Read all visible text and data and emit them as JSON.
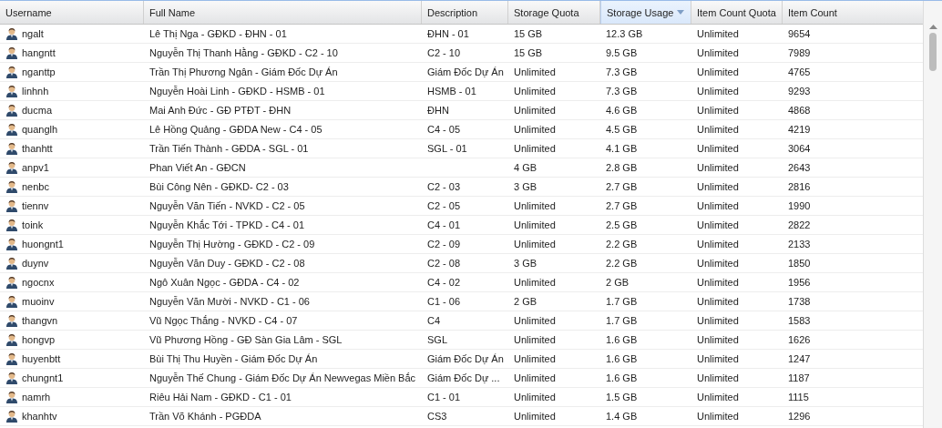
{
  "columns": [
    {
      "label": "Username",
      "sorted": false
    },
    {
      "label": "Full Name",
      "sorted": false
    },
    {
      "label": "Description",
      "sorted": false
    },
    {
      "label": "Storage Quota",
      "sorted": false
    },
    {
      "label": "Storage Usage",
      "sorted": true
    },
    {
      "label": "Item Count Quota",
      "sorted": false
    },
    {
      "label": "Item Count",
      "sorted": false
    }
  ],
  "rows": [
    [
      "ngalt",
      "Lê Thị Nga - GĐKD - ĐHN - 01",
      "ĐHN - 01",
      "15 GB",
      "12.3 GB",
      "Unlimited",
      "9654"
    ],
    [
      "hangntt",
      "Nguyễn Thị Thanh Hằng - GĐKD - C2 - 10",
      "C2 - 10",
      "15 GB",
      "9.5 GB",
      "Unlimited",
      "7989"
    ],
    [
      "nganttp",
      "Trần Thị Phương Ngân - Giám Đốc Dự Án",
      "Giám Đốc Dự Án",
      "Unlimited",
      "7.3 GB",
      "Unlimited",
      "4765"
    ],
    [
      "linhnh",
      "Nguyễn Hoài Linh - GĐKD - HSMB - 01",
      "HSMB - 01",
      "Unlimited",
      "7.3 GB",
      "Unlimited",
      "9293"
    ],
    [
      "ducma",
      "Mai Anh Đức - GĐ PTĐT - ĐHN",
      "ĐHN",
      "Unlimited",
      "4.6 GB",
      "Unlimited",
      "4868"
    ],
    [
      "quanglh",
      "Lê Hồng Quảng - GĐDA New - C4 - 05",
      "C4 - 05",
      "Unlimited",
      "4.5 GB",
      "Unlimited",
      "4219"
    ],
    [
      "thanhtt",
      "Trần Tiến Thành - GĐDA - SGL - 01",
      "SGL - 01",
      "Unlimited",
      "4.1 GB",
      "Unlimited",
      "3064"
    ],
    [
      "anpv1",
      "Phan Viết An - GĐCN",
      "",
      "4 GB",
      "2.8 GB",
      "Unlimited",
      "2643"
    ],
    [
      "nenbc",
      "Bùi Công Nên - GĐKD- C2 - 03",
      "C2 - 03",
      "3 GB",
      "2.7 GB",
      "Unlimited",
      "2816"
    ],
    [
      "tiennv",
      "Nguyễn Văn Tiến - NVKD - C2 - 05",
      "C2 - 05",
      "Unlimited",
      "2.7 GB",
      "Unlimited",
      "1990"
    ],
    [
      "toink",
      "Nguyễn Khắc Tới - TPKD - C4 - 01",
      "C4 - 01",
      "Unlimited",
      "2.5 GB",
      "Unlimited",
      "2822"
    ],
    [
      "huongnt1",
      "Nguyễn Thị Hường - GĐKD - C2 - 09",
      "C2 - 09",
      "Unlimited",
      "2.2 GB",
      "Unlimited",
      "2133"
    ],
    [
      "duynv",
      "Nguyễn Văn Duy - GĐKD - C2 - 08",
      "C2 - 08",
      "3 GB",
      "2.2 GB",
      "Unlimited",
      "1850"
    ],
    [
      "ngocnx",
      "Ngô Xuân Ngọc - GĐDA - C4 - 02",
      "C4 - 02",
      "Unlimited",
      "2 GB",
      "Unlimited",
      "1956"
    ],
    [
      "muoinv",
      "Nguyễn Văn Mười - NVKD - C1 - 06",
      "C1 - 06",
      "2 GB",
      "1.7 GB",
      "Unlimited",
      "1738"
    ],
    [
      "thangvn",
      "Vũ Ngọc Thắng - NVKD - C4 - 07",
      "C4",
      "Unlimited",
      "1.7 GB",
      "Unlimited",
      "1583"
    ],
    [
      "hongvp",
      "Vũ Phương Hồng - GĐ Sàn Gia Lâm - SGL",
      "SGL",
      "Unlimited",
      "1.6 GB",
      "Unlimited",
      "1626"
    ],
    [
      "huyenbtt",
      "Bùi Thị Thu Huyền - Giám Đốc Dự Án",
      "Giám Đốc Dự Án",
      "Unlimited",
      "1.6 GB",
      "Unlimited",
      "1247"
    ],
    [
      "chungnt1",
      "Nguyễn Thế Chung - Giám Đốc Dự Án Newvegas Miền Bắc",
      "Giám Đốc Dự ...",
      "Unlimited",
      "1.6 GB",
      "Unlimited",
      "1187"
    ],
    [
      "namrh",
      "Riêu Hải Nam - GĐKD - C1 - 01",
      "C1 - 01",
      "Unlimited",
      "1.5 GB",
      "Unlimited",
      "1115"
    ],
    [
      "khanhtv",
      "Trần Võ Khánh - PGĐDA",
      "CS3",
      "Unlimited",
      "1.4 GB",
      "Unlimited",
      "1296"
    ]
  ]
}
